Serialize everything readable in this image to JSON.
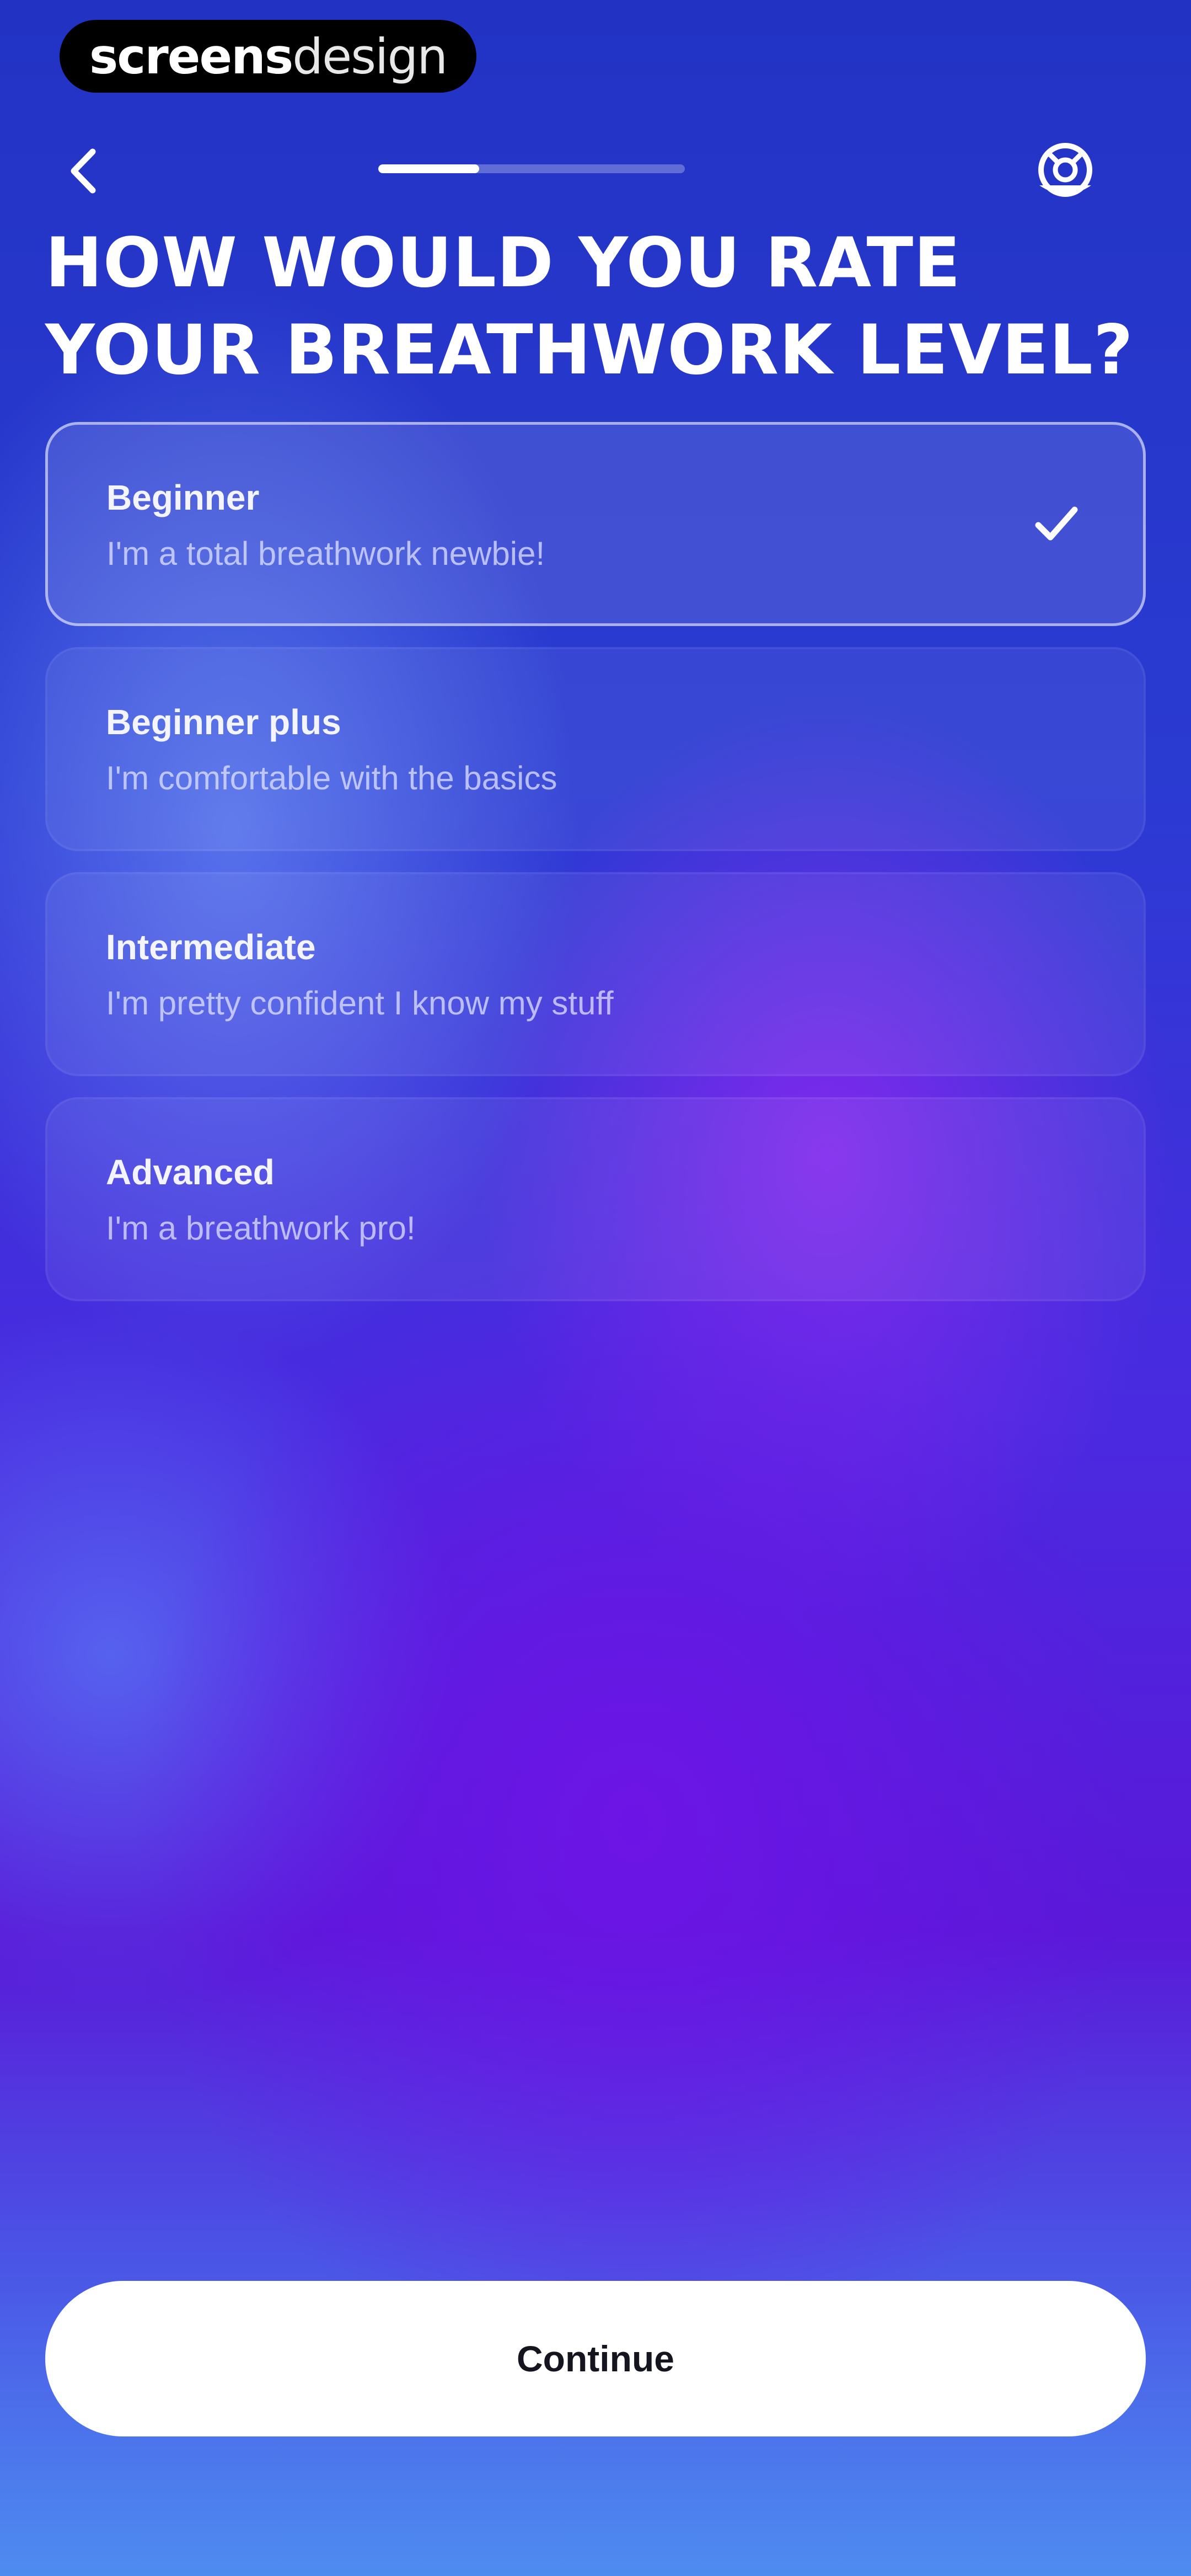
{
  "brand": {
    "bold": "screens",
    "light": "design"
  },
  "nav": {
    "back_icon": "chevron-left-icon",
    "hint_icon": "lifebuoy-icon",
    "progress_fraction": 0.33
  },
  "title": "HOW WOULD YOU RATE YOUR BREATHWORK LEVEL?",
  "options": [
    {
      "label": "Beginner",
      "description": "I'm a total breathwork newbie!",
      "selected": true
    },
    {
      "label": "Beginner plus",
      "description": "I'm comfortable with the basics",
      "selected": false
    },
    {
      "label": "Intermediate",
      "description": "I'm pretty confident I know my stuff",
      "selected": false
    },
    {
      "label": "Advanced",
      "description": "I'm a breathwork pro!",
      "selected": false
    }
  ],
  "continue_label": "Continue",
  "colors": {
    "background_top": "#2233c4",
    "background_mid": "#5a18d8",
    "background_bottom": "#4e8cf0",
    "button_bg": "#ffffff",
    "button_text": "#15151f"
  }
}
